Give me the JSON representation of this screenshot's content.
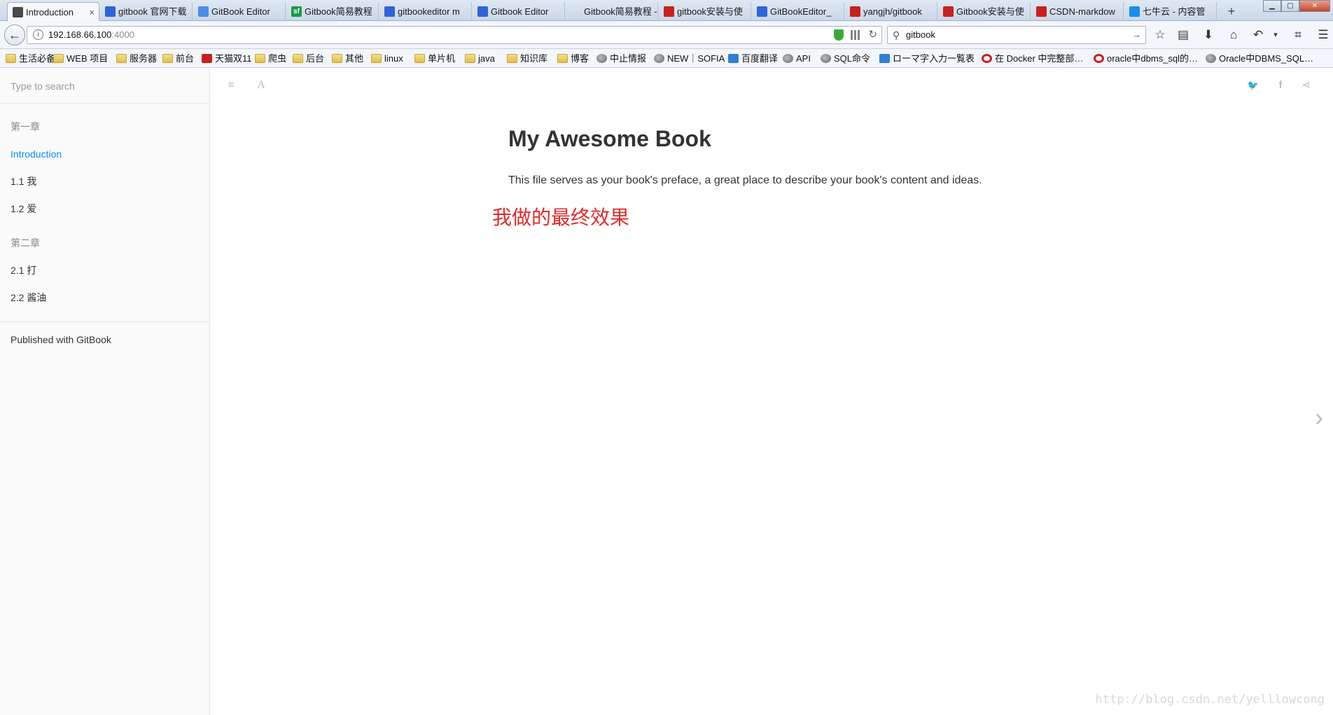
{
  "browser": {
    "tabs": [
      {
        "label": "Introduction",
        "icon": "book-icon",
        "color": "#4a4a4a",
        "active": true
      },
      {
        "label": "gitbook 官网下载",
        "icon": "baidu-paw-icon",
        "color": "#2f64d8"
      },
      {
        "label": "GitBook Editor",
        "icon": "gitbook-icon",
        "color": "#4a8fe8"
      },
      {
        "label": "Gitbook简易教程",
        "icon": "sf-icon",
        "color": "#1b9b48",
        "glyph": "sf"
      },
      {
        "label": "gitbookeditor m",
        "icon": "baidu-paw-icon",
        "color": "#2f64d8"
      },
      {
        "label": "Gitbook Editor",
        "icon": "baidu-paw-icon",
        "color": "#2f64d8"
      },
      {
        "label": "Gitbook简易教程 - V",
        "icon": "none",
        "color": ""
      },
      {
        "label": "gitbook安装与使",
        "icon": "csdn-icon",
        "color": "#c9201e"
      },
      {
        "label": "GitBookEditor_",
        "icon": "baidu-paw-icon",
        "color": "#2f64d8"
      },
      {
        "label": "yangjh/gitbook",
        "icon": "gitee-icon",
        "color": "#c9201e"
      },
      {
        "label": "Gitbook安装与使",
        "icon": "csdn-icon",
        "color": "#c9201e"
      },
      {
        "label": "CSDN-markdow",
        "icon": "csdn-icon",
        "color": "#c9201e"
      },
      {
        "label": "七牛云 - 内容管",
        "icon": "qiniu-icon",
        "color": "#1b8ee8"
      }
    ],
    "close_glyph": "×",
    "new_tab": "+",
    "url_host": "192.168.66.100",
    "url_port": ":4000",
    "search_value": "gitbook",
    "bookmarks": [
      {
        "label": "生活必备",
        "icon": "folder"
      },
      {
        "label": "WEB 项目",
        "icon": "folder"
      },
      {
        "label": "服务器",
        "icon": "folder"
      },
      {
        "label": "前台",
        "icon": "folder"
      },
      {
        "label": "天猫双11",
        "icon": "red"
      },
      {
        "label": "爬虫",
        "icon": "folder"
      },
      {
        "label": "后台",
        "icon": "folder"
      },
      {
        "label": "其他",
        "icon": "folder"
      },
      {
        "label": "linux",
        "icon": "folder"
      },
      {
        "label": "单片机",
        "icon": "folder"
      },
      {
        "label": "java",
        "icon": "folder"
      },
      {
        "label": "知识库",
        "icon": "folder"
      },
      {
        "label": "博客",
        "icon": "folder"
      },
      {
        "label": "中止情报",
        "icon": "globe"
      },
      {
        "label": "NEW｜SOFIA",
        "icon": "globe"
      },
      {
        "label": "百度翻译",
        "icon": "blue"
      },
      {
        "label": "API",
        "icon": "globe"
      },
      {
        "label": "SQL命令",
        "icon": "globe"
      },
      {
        "label": "ローマ字入力一覧表",
        "icon": "blue"
      },
      {
        "label": "在 Docker 中完整部…",
        "icon": "csdn"
      },
      {
        "label": "oracle中dbms_sql的…",
        "icon": "csdn"
      },
      {
        "label": "Oracle中DBMS_SQL…",
        "icon": "globe"
      }
    ]
  },
  "sidebar": {
    "search_placeholder": "Type to search",
    "chapters": [
      {
        "header": "第一章",
        "items": [
          {
            "label": "Introduction",
            "active": true
          },
          {
            "label": "1.1 我"
          },
          {
            "label": "1.2 爱"
          }
        ]
      },
      {
        "header": "第二章",
        "items": [
          {
            "label": "2.1 打"
          },
          {
            "label": "2.2 酱油"
          }
        ]
      }
    ],
    "published": "Published with GitBook"
  },
  "article": {
    "title": "My Awesome Book",
    "paragraph": "This file serves as your book's preface, a great place to describe your book's content and ideas."
  },
  "annotation": "我做的最终效果",
  "watermark": "http://blog.csdn.net/yelllowcong",
  "colors": {
    "accent": "#008cff",
    "annotation": "#e02a2a"
  }
}
